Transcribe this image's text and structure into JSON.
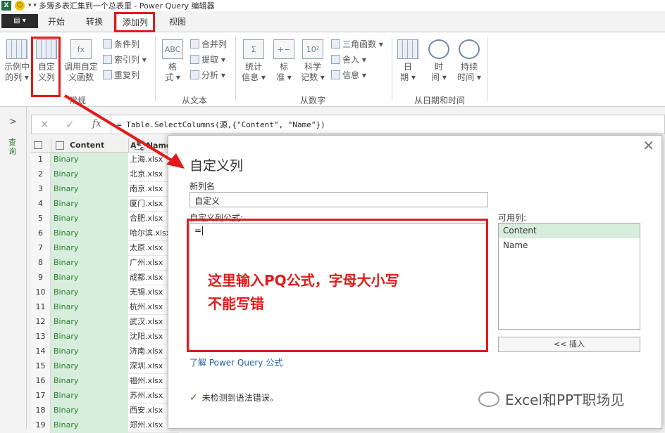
{
  "titlebar": {
    "title": "多簿多表汇集到一个总表里 - Power Query 编辑器"
  },
  "menu": {
    "file": "",
    "tabs": [
      "开始",
      "转换",
      "添加列",
      "视图"
    ],
    "active_tab": "添加列"
  },
  "ribbon": {
    "example": [
      "示例中",
      "的列 ▾"
    ],
    "custom": [
      "自定",
      "义列"
    ],
    "invoke": [
      "调用自定",
      "义函数"
    ],
    "general_small": [
      "条件列",
      "索引列 ▾",
      "重复列"
    ],
    "group_general": "常规",
    "format": [
      "格",
      "式 ▾"
    ],
    "text_small": [
      "合并列",
      "提取 ▾",
      "分析 ▾"
    ],
    "group_text": "从文本",
    "stats": [
      "统计",
      "信息 ▾"
    ],
    "standard": [
      "标",
      "准 ▾"
    ],
    "science": [
      "科学",
      "记数 ▾"
    ],
    "number_small": [
      "三角函数 ▾",
      "舍入 ▾",
      "信息 ▾"
    ],
    "group_number": "从数字",
    "date": [
      "日",
      "期 ▾"
    ],
    "time": [
      "时",
      "间 ▾"
    ],
    "duration": [
      "持续",
      "时间 ▾"
    ],
    "group_datetime": "从日期和时间"
  },
  "side": {
    "label": "查询"
  },
  "formula_bar": {
    "cancel": "✕",
    "confirm": "✓",
    "fx": "fx",
    "formula": "= Table.SelectColumns(源,{\"Content\", \"Name\"})"
  },
  "table": {
    "col1": "Content",
    "col2": "Name",
    "rows": [
      {
        "n": "1",
        "content": "Binary",
        "name": "上海.xlsx"
      },
      {
        "n": "2",
        "content": "Binary",
        "name": "北京.xlsx"
      },
      {
        "n": "3",
        "content": "Binary",
        "name": "南京.xlsx"
      },
      {
        "n": "4",
        "content": "Binary",
        "name": "厦门.xlsx"
      },
      {
        "n": "5",
        "content": "Binary",
        "name": "合肥.xlsx"
      },
      {
        "n": "6",
        "content": "Binary",
        "name": "哈尔滨.xlsx"
      },
      {
        "n": "7",
        "content": "Binary",
        "name": "太原.xlsx"
      },
      {
        "n": "8",
        "content": "Binary",
        "name": "广州.xlsx"
      },
      {
        "n": "9",
        "content": "Binary",
        "name": "成都.xlsx"
      },
      {
        "n": "10",
        "content": "Binary",
        "name": "无锡.xlsx"
      },
      {
        "n": "11",
        "content": "Binary",
        "name": "杭州.xlsx"
      },
      {
        "n": "12",
        "content": "Binary",
        "name": "武汉.xlsx"
      },
      {
        "n": "13",
        "content": "Binary",
        "name": "沈阳.xlsx"
      },
      {
        "n": "14",
        "content": "Binary",
        "name": "济南.xlsx"
      },
      {
        "n": "15",
        "content": "Binary",
        "name": "深圳.xlsx"
      },
      {
        "n": "16",
        "content": "Binary",
        "name": "福州.xlsx"
      },
      {
        "n": "17",
        "content": "Binary",
        "name": "苏州.xlsx"
      },
      {
        "n": "18",
        "content": "Binary",
        "name": "西安.xlsx"
      },
      {
        "n": "19",
        "content": "Binary",
        "name": "郑州.xlsx"
      }
    ]
  },
  "dialog": {
    "title": "自定义列",
    "new_col_label": "新列名",
    "new_col_value": "自定义",
    "formula_label": "自定义列公式:",
    "formula_value": "=",
    "available_label": "可用列:",
    "available": [
      "Content",
      "Name"
    ],
    "insert": "<< 插入",
    "learn_link": "了解 Power Query 公式",
    "status": "未检测到语法错误。",
    "annotation": [
      "这里输入PQ公式，字母大小写",
      "不能写错"
    ]
  },
  "watermark": "Excel和PPT职场见",
  "colors": {
    "highlight": "#e21a1a",
    "accent_green": "#2e7d32"
  }
}
